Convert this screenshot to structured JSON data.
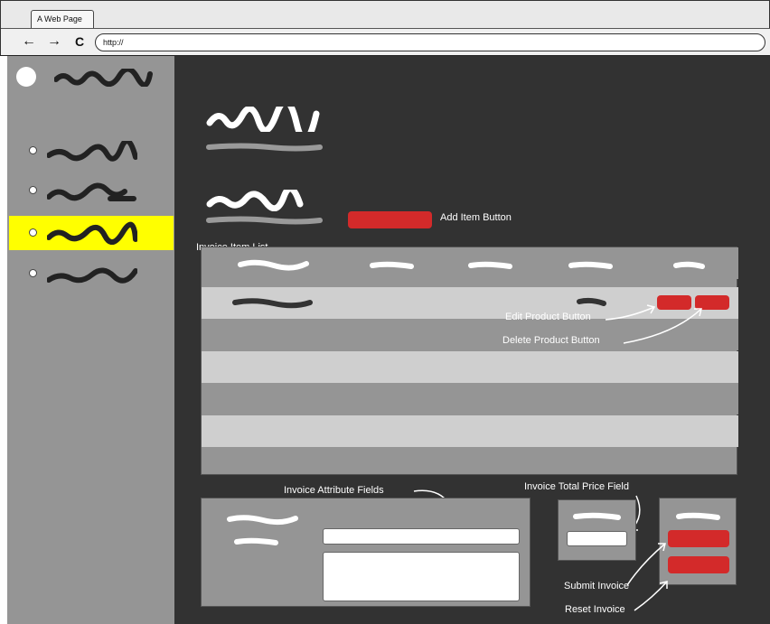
{
  "browser": {
    "tab_title": "A Web Page",
    "back_icon": "←",
    "forward_icon": "→",
    "reload_icon": "C",
    "url": "http://"
  },
  "labels": {
    "add_item_button": "Add Item Button",
    "invoice_item_list": "Invoice Item List",
    "edit_product_button": "Edit Product Button",
    "delete_product_button": "Delete Product Button",
    "invoice_attribute_fields": "Invoice Attribute Fields",
    "invoice_total_price_field": "Invoice Total Price Field",
    "submit_invoice": "Submit Invoice",
    "reset_invoice": "Reset Invoice"
  },
  "colors": {
    "main_bg": "#323232",
    "sidebar_bg": "#959595",
    "active_item": "#ffff00",
    "button_red": "#d32a2a",
    "row_light": "#cfcfcf",
    "row_dark": "#959595"
  }
}
